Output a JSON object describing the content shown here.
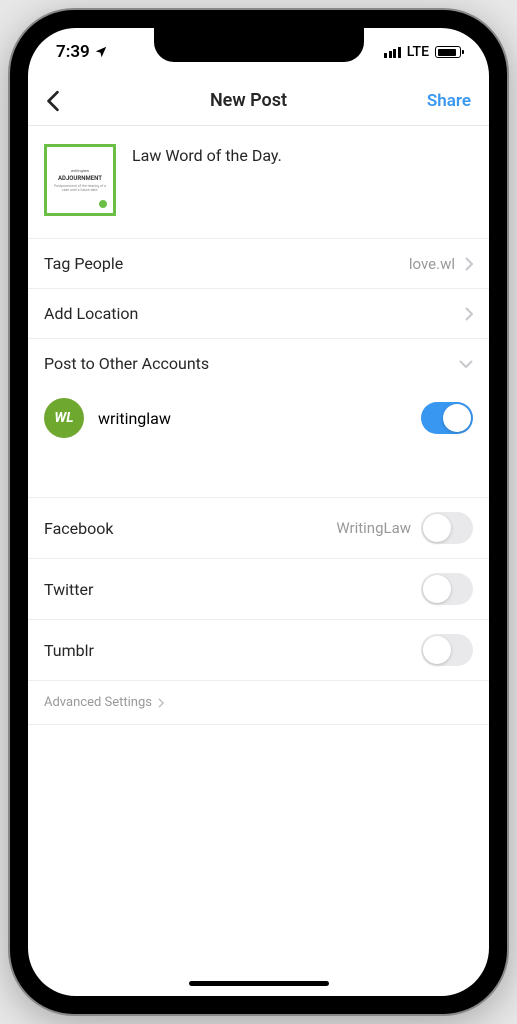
{
  "status": {
    "time": "7:39",
    "network": "LTE"
  },
  "nav": {
    "title": "New Post",
    "share": "Share"
  },
  "caption": {
    "text": "Law Word of the Day.",
    "thumb_heading": "ADJOURNMENT"
  },
  "rows": {
    "tag_people": {
      "label": "Tag People",
      "value": "love.wl"
    },
    "add_location": {
      "label": "Add Location"
    },
    "post_other": {
      "label": "Post to Other Accounts"
    }
  },
  "account": {
    "avatar_text": "WL",
    "username": "writinglaw"
  },
  "sharing": [
    {
      "name": "Facebook",
      "value": "WritingLaw",
      "on": false
    },
    {
      "name": "Twitter",
      "value": "",
      "on": false
    },
    {
      "name": "Tumblr",
      "value": "",
      "on": false
    }
  ],
  "advanced": "Advanced Settings"
}
